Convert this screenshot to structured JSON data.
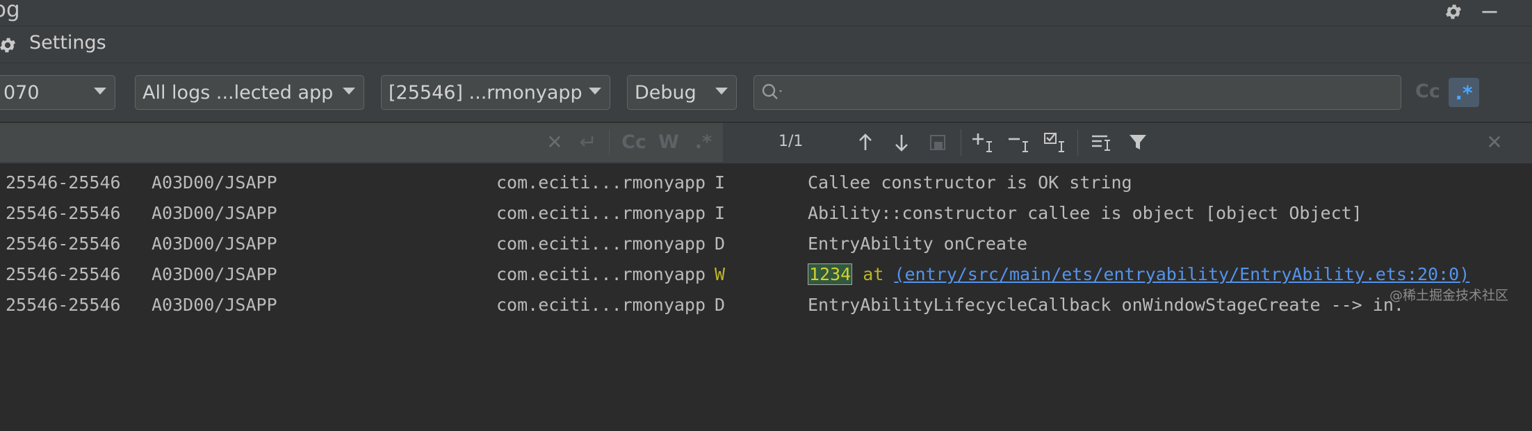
{
  "window": {
    "title": "og"
  },
  "settings": {
    "label": "Settings"
  },
  "filters": {
    "device": "070",
    "log_scope": "All logs ...lected app",
    "process": "[25546] ...rmonyapp",
    "level": "Debug",
    "search_value": "",
    "case_label": "Cc",
    "regex_label": ".*"
  },
  "log_toolbar": {
    "case_label": "Cc",
    "words_label": "W",
    "regex_label": ".*",
    "match_count": "1/1"
  },
  "logs": [
    {
      "pid": "25546-25546",
      "tag": "A03D00/JSAPP",
      "package": "com.eciti...rmonyapp",
      "level": "I",
      "message": "Callee constructor is OK string"
    },
    {
      "pid": "25546-25546",
      "tag": "A03D00/JSAPP",
      "package": "com.eciti...rmonyapp",
      "level": "I",
      "message": "Ability::constructor callee is object [object Object]"
    },
    {
      "pid": "25546-25546",
      "tag": "A03D00/JSAPP",
      "package": "com.eciti...rmonyapp",
      "level": "D",
      "message": "EntryAbility onCreate"
    },
    {
      "pid": "25546-25546",
      "tag": "A03D00/JSAPP",
      "package": "com.eciti...rmonyapp",
      "level": "W",
      "message_highlight": "1234",
      "message_mid": " at ",
      "message_link": "(entry/src/main/ets/entryability/EntryAbility.ets:20:0)"
    },
    {
      "pid": "25546-25546",
      "tag": "A03D00/JSAPP",
      "package": "com.eciti...rmonyapp",
      "level": "D",
      "message": "EntryAbilityLifecycleCallback onWindowStageCreate --> in."
    }
  ],
  "watermark": "@稀土掘金技术社区",
  "colors": {
    "background": "#2b2b2b",
    "panel": "#3c3f41",
    "warning": "#bbb529",
    "link": "#5394ec",
    "accent": "#4aa7ff"
  }
}
